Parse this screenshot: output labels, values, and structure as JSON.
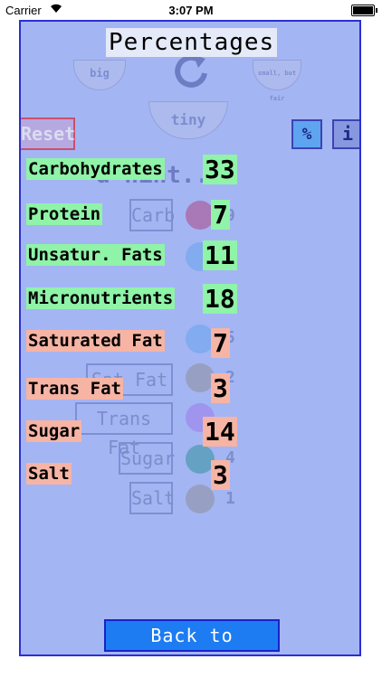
{
  "status_bar": {
    "carrier": "Carrier",
    "time": "3:07 PM"
  },
  "title": "Percentages",
  "background": {
    "bowls": {
      "big": "big",
      "tiny": "tiny",
      "small": "small, but fair"
    },
    "heading_fragment": "d hint...",
    "buttons": [
      "Carb",
      "Sat Fat",
      "Trans Fat",
      "Sugar",
      "Salt"
    ],
    "counts": [
      "9",
      "5",
      "2",
      "4",
      "1"
    ]
  },
  "buttons": {
    "reset": "Reset",
    "percent": "%",
    "info": "i",
    "back": "Back to Tracker"
  },
  "nutrients": [
    {
      "name": "Carbohydrates",
      "value": "33",
      "kind": "good"
    },
    {
      "name": "Protein",
      "value": "7",
      "kind": "good"
    },
    {
      "name": "Unsatur. Fats",
      "value": "11",
      "kind": "good"
    },
    {
      "name": "Micronutrients",
      "value": "18",
      "kind": "good"
    },
    {
      "name": "Saturated Fat",
      "value": "7",
      "kind": "bad"
    },
    {
      "name": "Trans Fat",
      "value": "3",
      "kind": "bad"
    },
    {
      "name": "Sugar",
      "value": "14",
      "kind": "bad"
    },
    {
      "name": "Salt",
      "value": "3",
      "kind": "bad"
    }
  ],
  "colors": {
    "panel": "#a4b5f3",
    "good": "#8ff3a8",
    "bad": "#f6b4a4",
    "accent": "#1d7cf2"
  }
}
